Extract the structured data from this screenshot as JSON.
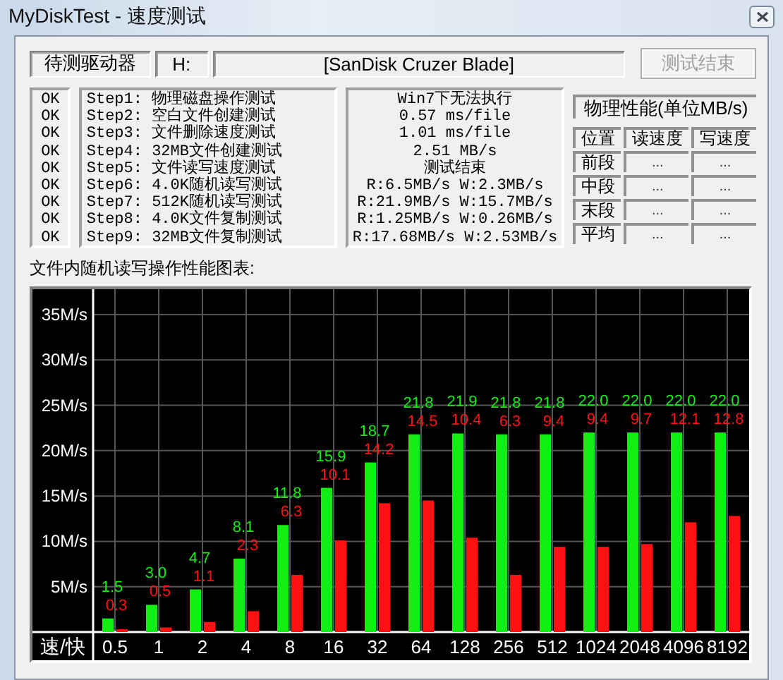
{
  "window": {
    "title": "MyDiskTest - 速度测试"
  },
  "drive": {
    "label": "待测驱动器",
    "letter": "H:",
    "name": "[SanDisk Cruzer Blade]"
  },
  "stop_button": {
    "label": "测试结束",
    "disabled": true
  },
  "steps": [
    {
      "status": "OK",
      "name": "Step1: 物理磁盘操作测试",
      "result": "Win7下无法执行"
    },
    {
      "status": "OK",
      "name": "Step2: 空白文件创建测试",
      "result": "0.57 ms/file"
    },
    {
      "status": "OK",
      "name": "Step3: 文件删除速度测试",
      "result": "1.01 ms/file"
    },
    {
      "status": "OK",
      "name": "Step4: 32MB文件创建测试",
      "result": "2.51 MB/s"
    },
    {
      "status": "OK",
      "name": "Step5: 文件读写速度测试",
      "result": "测试结束"
    },
    {
      "status": "OK",
      "name": "Step6: 4.0K随机读写测试",
      "result": "R:6.5MB/s W:2.3MB/s"
    },
    {
      "status": "OK",
      "name": "Step7: 512K随机读写测试",
      "result": "R:21.9MB/s W:15.7MB/s"
    },
    {
      "status": "OK",
      "name": "Step8: 4.0K文件复制测试",
      "result": "R:1.25MB/s W:0.26MB/s"
    },
    {
      "status": "OK",
      "name": "Step9: 32MB文件复制测试",
      "result": "R:17.68MB/s W:2.53MB/s"
    }
  ],
  "physical": {
    "title": "物理性能(单位MB/s)",
    "columns": [
      "位置",
      "读速度",
      "写速度"
    ],
    "rows": [
      [
        "前段",
        "...",
        "..."
      ],
      [
        "中段",
        "...",
        "..."
      ],
      [
        "末段",
        "...",
        "..."
      ],
      [
        "平均",
        "...",
        "..."
      ]
    ]
  },
  "chart": {
    "title": "文件内随机读写操作性能图表:",
    "corner_label": "速/快",
    "chart_data": {
      "type": "bar",
      "categories": [
        "0.5",
        "1",
        "2",
        "4",
        "8",
        "16",
        "32",
        "64",
        "128",
        "256",
        "512",
        "1024",
        "2048",
        "4096",
        "8192"
      ],
      "series": [
        {
          "color": "#11ee11",
          "values": [
            1.5,
            3.0,
            4.7,
            8.1,
            11.8,
            15.9,
            18.7,
            21.8,
            21.9,
            21.8,
            21.8,
            22.0,
            22.0,
            22.0,
            22.0
          ],
          "value_labels": [
            "1.5",
            "3.0",
            "4.7",
            "8.1",
            "11.8",
            "15.9",
            "18.7",
            "21.8",
            "21.9",
            "21.8",
            "21.8",
            "22.0",
            "22.0",
            "22.0",
            "22.0"
          ]
        },
        {
          "color": "#ff1111",
          "values": [
            0.3,
            0.5,
            1.1,
            2.3,
            6.3,
            10.1,
            14.2,
            14.5,
            10.4,
            6.3,
            9.4,
            9.4,
            9.7,
            12.1,
            12.8
          ]
        }
      ],
      "annotations": [
        "0.3",
        "0.5",
        "1.1",
        "2.3",
        "6.3",
        "10.1",
        "14.2",
        "14.5",
        "10.4",
        "6.3",
        "9.4",
        "9.4",
        "9.7",
        "12.1",
        "12.8"
      ],
      "grid": true,
      "ylim": [
        0,
        37.8
      ],
      "yticks": [
        {
          "value": 5,
          "label": "5M/s"
        },
        {
          "value": 10,
          "label": "10M/s"
        },
        {
          "value": 15,
          "label": "15M/s"
        },
        {
          "value": 20,
          "label": "20M/s"
        },
        {
          "value": 25,
          "label": "25M/s"
        },
        {
          "value": 30,
          "label": "30M/s"
        },
        {
          "value": 35,
          "label": "35M/s"
        }
      ],
      "orientation": "vertical"
    }
  }
}
